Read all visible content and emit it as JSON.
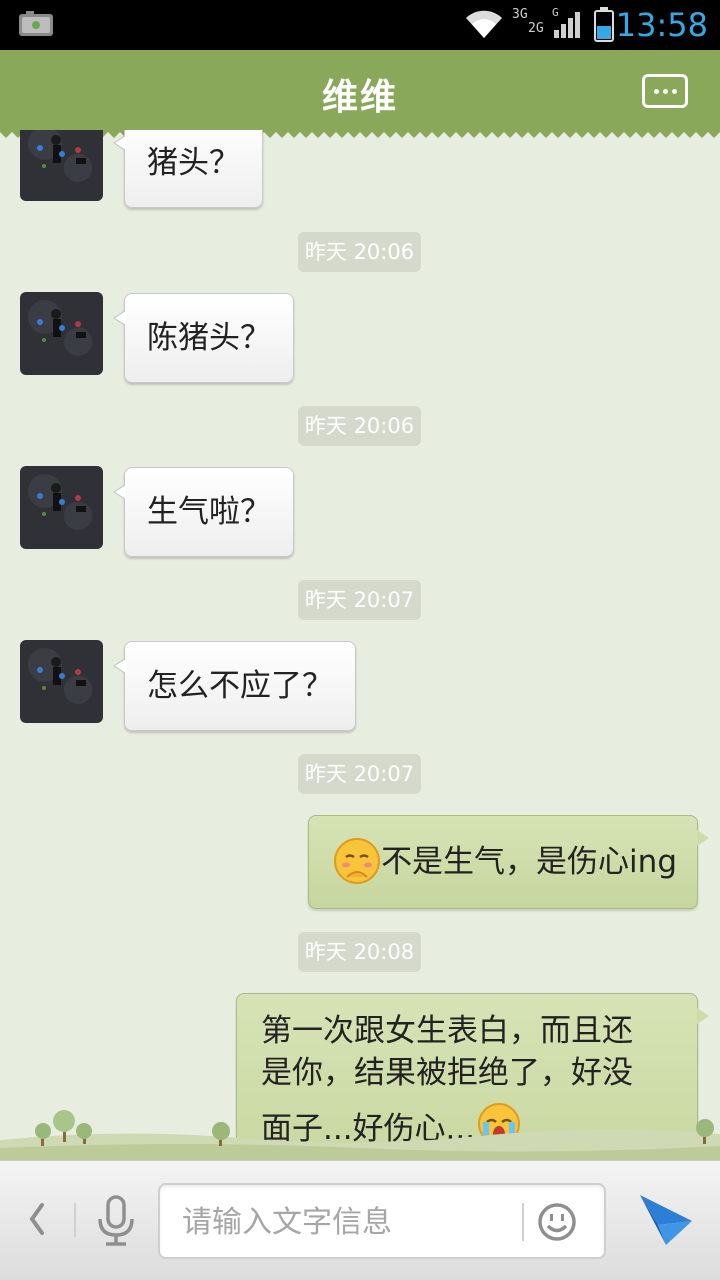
{
  "status_bar": {
    "time": "13:58",
    "network_labels": [
      "3G",
      "2G",
      "G"
    ],
    "accent_color": "#35a8e6"
  },
  "header": {
    "title": "维维",
    "menu_icon": "more-options-icon",
    "background_color": "#8aa85a"
  },
  "messages": [
    {
      "type": "in",
      "text": "猪头？"
    },
    {
      "type": "time",
      "text": "昨天 20:06"
    },
    {
      "type": "in",
      "text": "陈猪头？"
    },
    {
      "type": "time",
      "text": "昨天 20:06"
    },
    {
      "type": "in",
      "text": "生气啦？"
    },
    {
      "type": "time",
      "text": "昨天 20:07"
    },
    {
      "type": "in",
      "text": "怎么不应了？"
    },
    {
      "type": "time",
      "text": "昨天 20:07"
    },
    {
      "type": "out",
      "emoji": "shy-face-emoji",
      "text": "不是生气，是伤心ing"
    },
    {
      "type": "time",
      "text": "昨天 20:08"
    },
    {
      "type": "out",
      "lines": [
        "第一次跟女生表白，而且还",
        "是你，结果被拒绝了，好没",
        "面子...好伤心..."
      ],
      "emoji": "crying-face-emoji"
    }
  ],
  "input_bar": {
    "back_icon": "chevron-left-icon",
    "voice_icon": "microphone-icon",
    "placeholder": "请输入文字信息",
    "emoji_icon": "smiley-icon",
    "send_icon": "send-arrow-icon"
  }
}
